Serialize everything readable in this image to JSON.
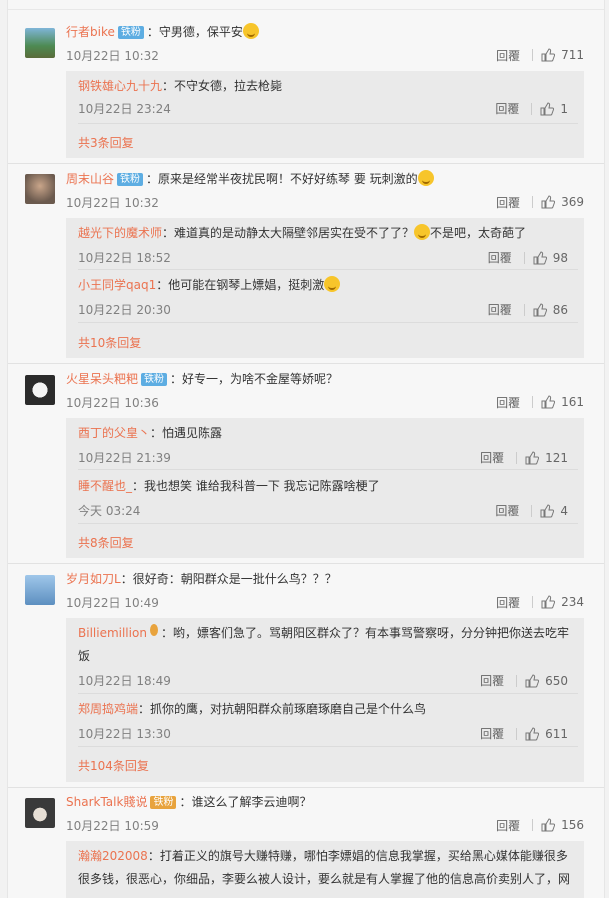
{
  "reply_label": "回覆",
  "threads": [
    {
      "name": "行者bike",
      "badge": "铁粉",
      "text": "：守男德，保平安",
      "time": "10月22日 10:32",
      "likes": "711",
      "replies": [
        {
          "name": "钢铁雄心九十九",
          "text": "：不守女德，拉去枪毙",
          "time": "10月22日 23:24",
          "likes": "1"
        }
      ],
      "more": "共3条回复"
    },
    {
      "name": "周末山谷",
      "badge": "铁粉",
      "text": "：原来是经常半夜扰民啊！不好好练琴 要 玩刺激的",
      "time": "10月22日 10:32",
      "likes": "369",
      "replies": [
        {
          "name": "越光下的魔术师",
          "text": "：难道真的是动静太大隔壁邻居实在受不了了？",
          "text2": "不是吧，太奇葩了",
          "time": "10月22日 18:52",
          "likes": "98"
        },
        {
          "name": "小王同学qaq1",
          "text": "：他可能在钢琴上嫖娼，挺刺激",
          "time": "10月22日 20:30",
          "likes": "86"
        }
      ],
      "more": "共10条回复"
    },
    {
      "name": "火星呆头粑粑",
      "badge": "铁粉",
      "text": "：好专一，为啥不金屋等娇呢？",
      "time": "10月22日 10:36",
      "likes": "161",
      "replies": [
        {
          "name": "酉丁的父皇丶",
          "text": "：怕遇见陈露",
          "time": "10月22日 21:39",
          "likes": "121"
        },
        {
          "name": "睡不醒也_",
          "text": "：我也想笑 谁给我科普一下 我忘记陈露啥梗了",
          "time": "今天 03:24",
          "likes": "4"
        }
      ],
      "more": "共8条回复"
    },
    {
      "name": "岁月如刀L",
      "text": "：很好奇：朝阳群众是一批什么鸟？？？",
      "time": "10月22日 10:49",
      "likes": "234",
      "replies": [
        {
          "name": "Billiemillion",
          "text": "：哟，嫖客们急了。骂朝阳区群众了？有本事骂警察呀，分分钟把你送去吃牢饭",
          "time": "10月22日 18:49",
          "likes": "650"
        },
        {
          "name": "郑周捣鸡端",
          "text": "：抓你的鹰，对抗朝阳群众前琢磨琢磨自己是个什么鸟",
          "time": "10月22日 13:30",
          "likes": "611"
        }
      ],
      "more": "共104条回复"
    },
    {
      "name": "SharkTalk賤说",
      "badge": "铁粉",
      "text": "：谁这么了解李云迪啊？",
      "time": "10月22日 10:59",
      "likes": "156",
      "replies": [
        {
          "name": "瀚瀚202008",
          "text": "：打着正义的旗号大赚特赚，哪怕李嫖娼的信息我掌握，买给黑心媒体能赚很多很多钱，很恶心，你细品，李要么被人设计，要么就是有人掌握了他的信息高价卖别人了，网"
        }
      ]
    }
  ]
}
